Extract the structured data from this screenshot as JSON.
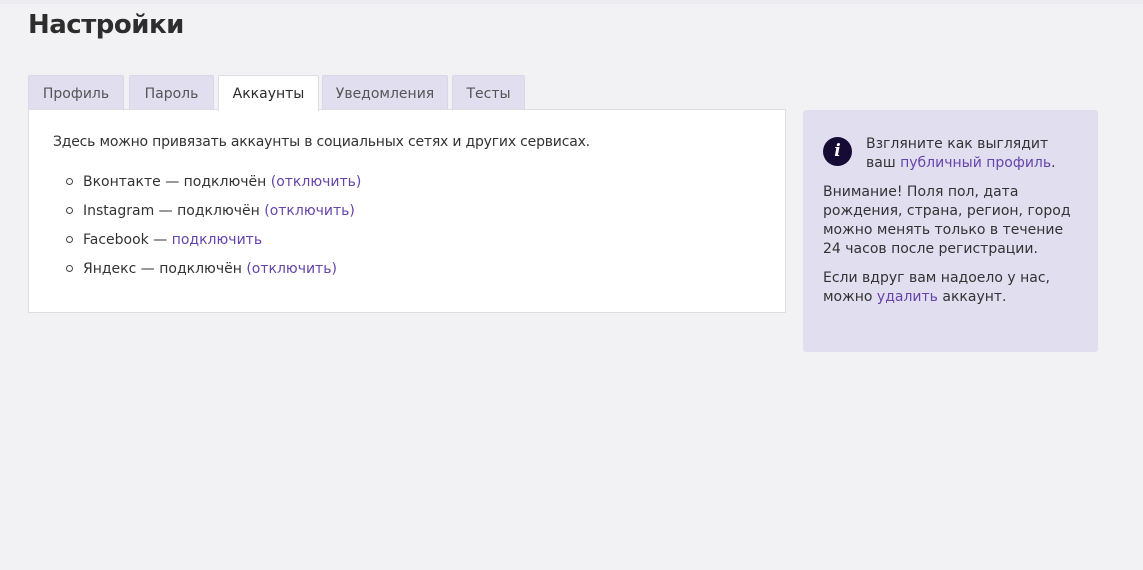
{
  "page": {
    "title": "Настройки"
  },
  "tabs": [
    {
      "label": "Профиль",
      "active": false
    },
    {
      "label": "Пароль",
      "active": false
    },
    {
      "label": "Аккаунты",
      "active": true
    },
    {
      "label": "Уведомления",
      "active": false
    },
    {
      "label": "Тесты",
      "active": false
    }
  ],
  "accounts": {
    "intro": "Здесь можно привязать аккаунты в социальных сетях и других сервисах.",
    "items": [
      {
        "service": "Вконтакте",
        "status": " — подключён ",
        "open": "(",
        "action": "отключить",
        "close": ")"
      },
      {
        "service": "Instagram",
        "status": " — подключён ",
        "open": "(",
        "action": "отключить",
        "close": ")"
      },
      {
        "service": "Facebook",
        "status": " — ",
        "open": "",
        "action": "подключить",
        "close": ""
      },
      {
        "service": "Яндекс",
        "status": " — подключён ",
        "open": "(",
        "action": "отключить",
        "close": ")"
      }
    ]
  },
  "sidebar": {
    "icon": "info-icon",
    "icon_glyph": "i",
    "profile_text": "Взгляните как выглядит ваш",
    "profile_link": "публичный профиль",
    "profile_end": ".",
    "warning": "Внимание! Поля пол, дата рождения, страна, регион, город можно менять только в течение 24 часов после регистрации.",
    "delete_text": "Если вдруг вам надоело у нас, можно",
    "delete_link": "удалить",
    "delete_end": " аккаунт."
  },
  "colors": {
    "accent_link": "#6644aa",
    "tab_bg": "#e1def0",
    "sidebar_bg": "#e1def0",
    "icon_bg": "#150b35",
    "page_bg": "#f2f2f5"
  }
}
